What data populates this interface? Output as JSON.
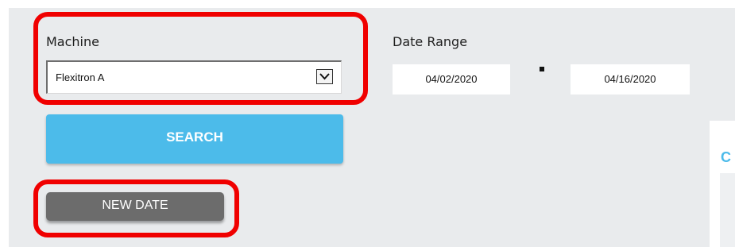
{
  "filters": {
    "machine_label": "Machine",
    "machine_selected": "Flexitron A",
    "date_range_label": "Date Range",
    "date_from": "04/02/2020",
    "date_separator": "-",
    "date_to": "04/16/2020"
  },
  "buttons": {
    "search_label": "SEARCH",
    "new_date_label": "NEW DATE"
  },
  "right_panel": {
    "title_fragment": "C"
  },
  "colors": {
    "accent": "#4cbbea",
    "highlight": "#f00000",
    "secondary_button": "#6c6c6c",
    "panel_bg": "#e9ebed"
  },
  "icons": {
    "select_arrow": "chevron-down-icon"
  }
}
